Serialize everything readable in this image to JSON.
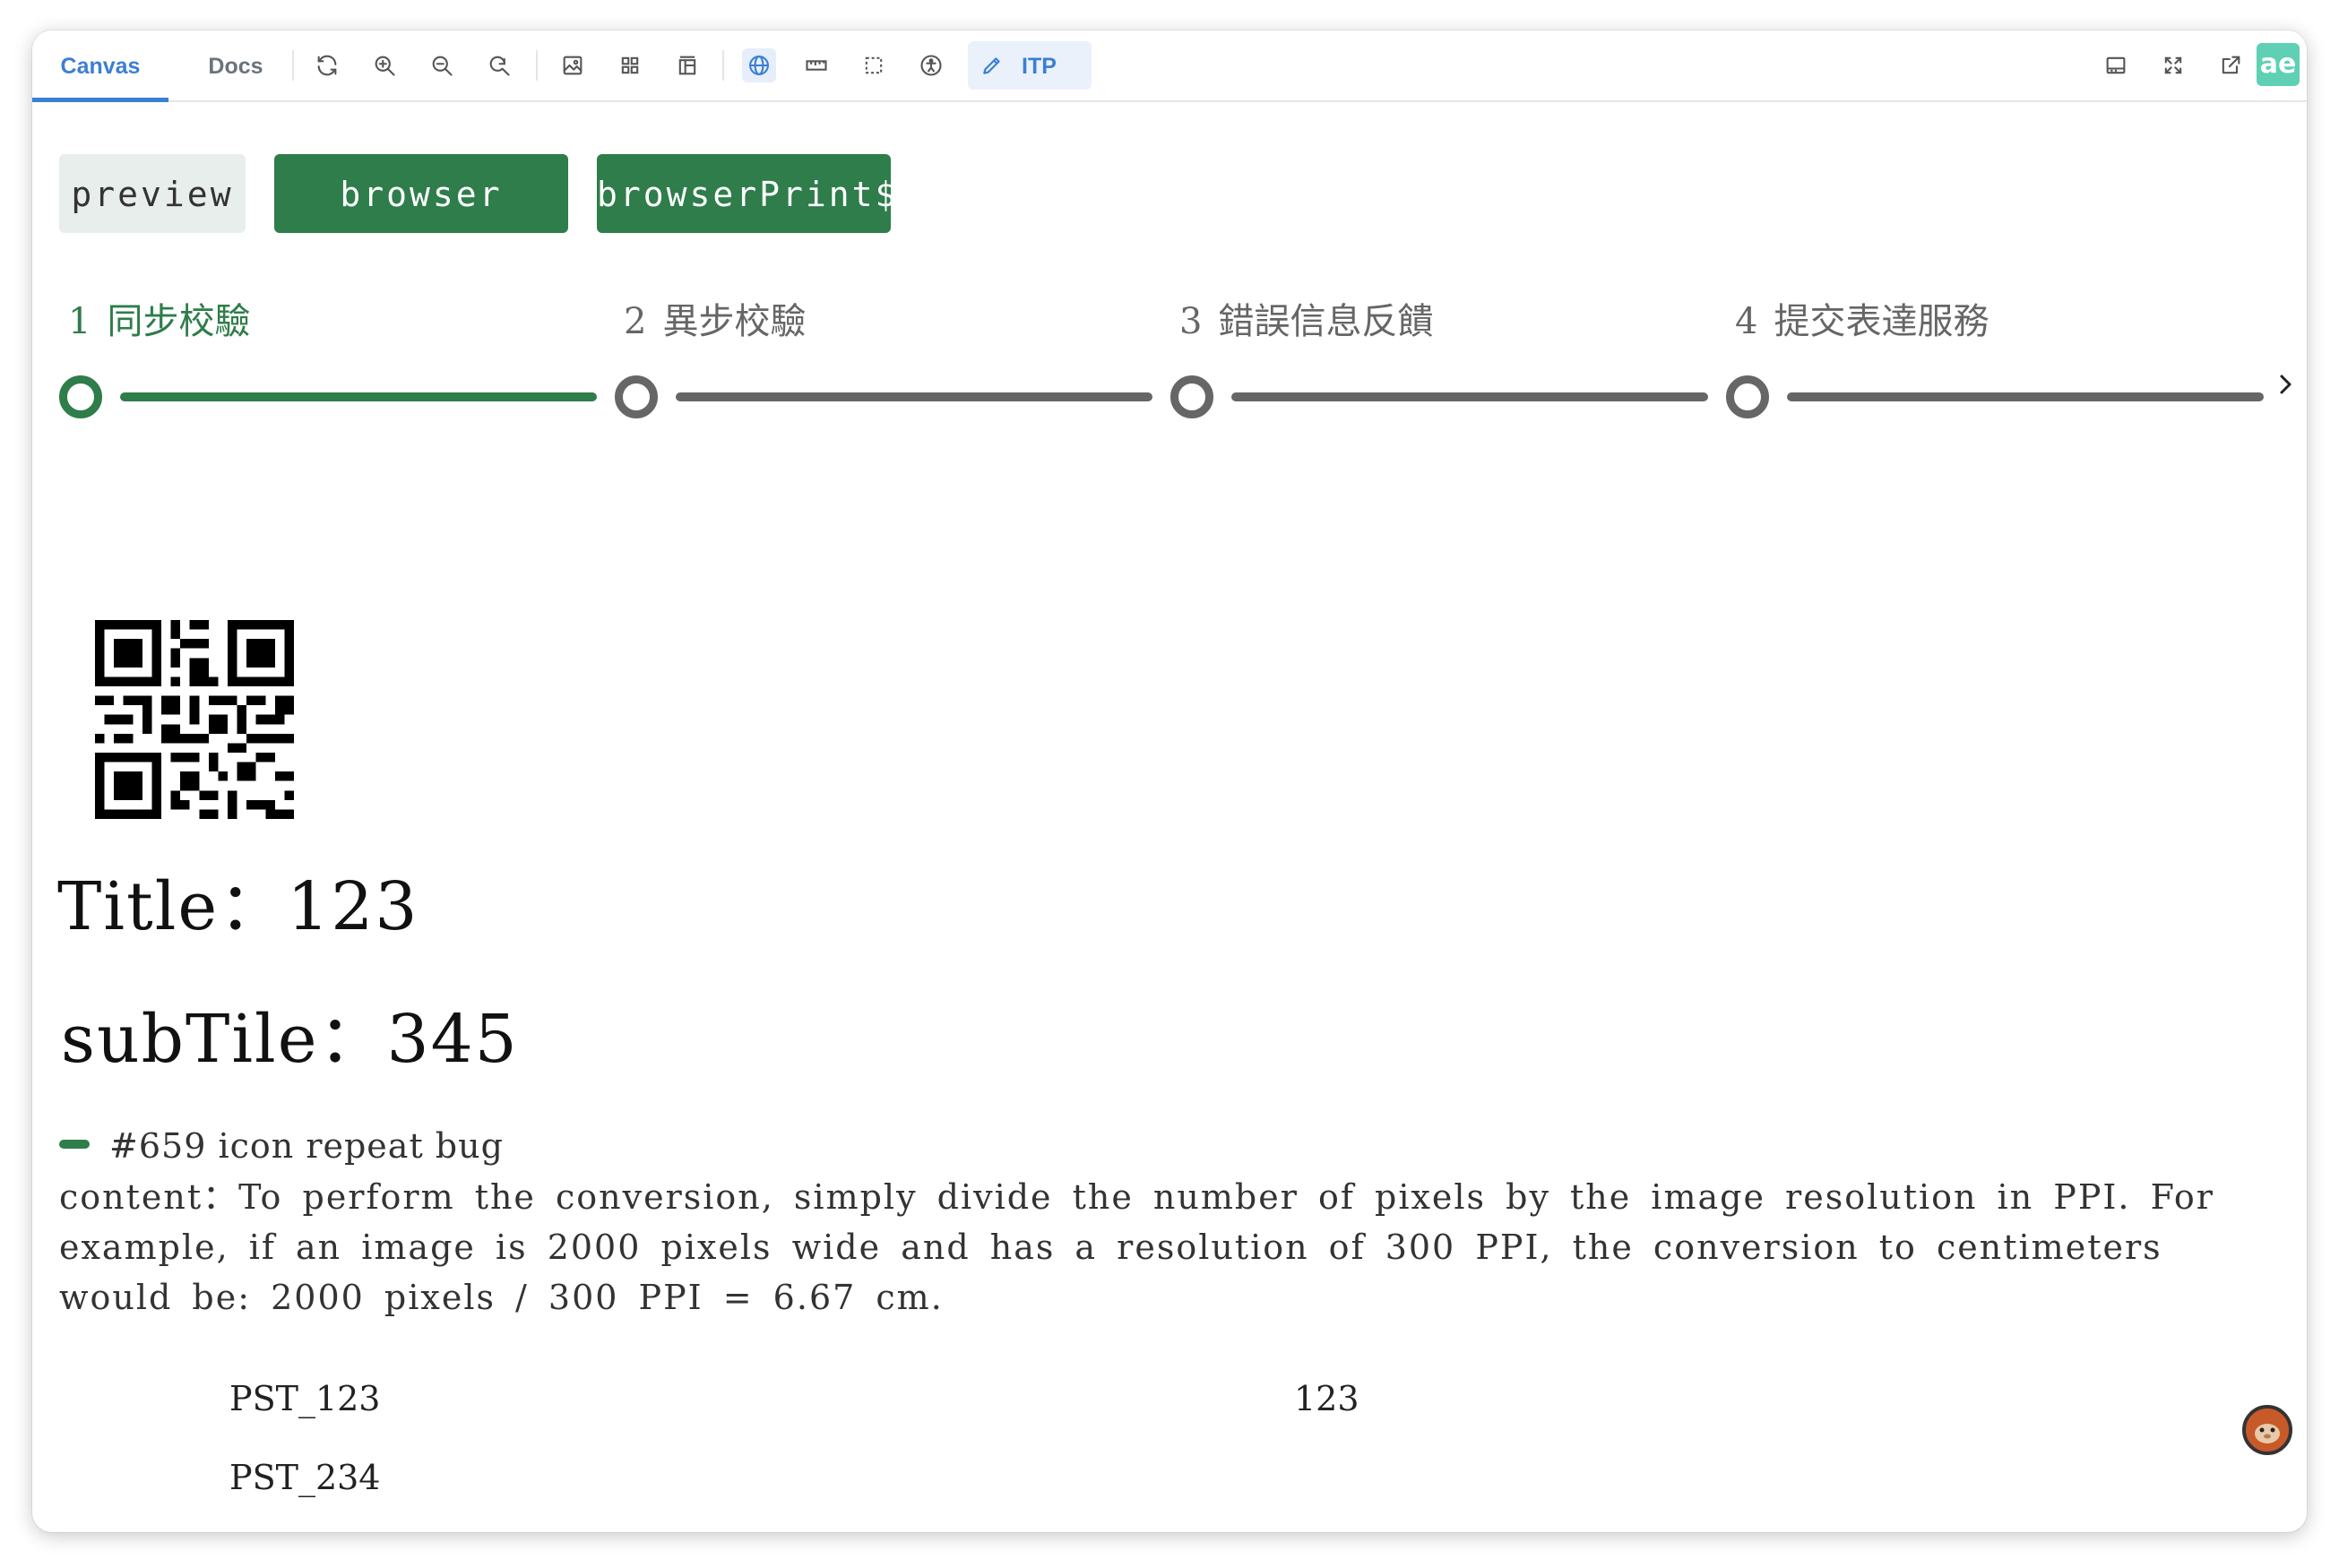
{
  "tabs": [
    {
      "label": "Canvas",
      "active": true
    },
    {
      "label": "Docs",
      "active": false
    }
  ],
  "toolbar": {
    "icons": [
      "refresh-icon",
      "zoom-in-icon",
      "zoom-out-icon",
      "zoom-reset-icon",
      "image-icon",
      "grid-icon",
      "layout-icon",
      "globe-icon",
      "ruler-icon",
      "outline-icon",
      "accessibility-icon"
    ],
    "itp_label": "ITP",
    "right_icons": [
      "panel-icon",
      "fullscreen-icon",
      "open-external-icon"
    ],
    "brand": "ae",
    "accent_color": "#3b7fd4"
  },
  "buttons": {
    "preview": "preview",
    "browser_print": "browser print",
    "browser_print_obs": "browserPrint$"
  },
  "steps": [
    {
      "num": "1",
      "label": "同步校驗",
      "active": true
    },
    {
      "num": "2",
      "label": "異步校驗",
      "active": false
    },
    {
      "num": "3",
      "label": "錯誤信息反饋",
      "active": false
    },
    {
      "num": "4",
      "label": "提交表達服務",
      "active": false
    }
  ],
  "step_colors": {
    "active": "#2e7d4a",
    "inactive": "#666666"
  },
  "doc": {
    "title": "Title：123",
    "subtitle": "subTile：345",
    "tag": "#659 icon repeat bug",
    "content": "content：To perform the conversion, simply divide the number of pixels by the image resolution in PPI. For example, if an image is 2000 pixels wide and has a resolution of 300 PPI, the conversion to centimeters would be: 2000 pixels / 300 PPI = 6.67 cm.",
    "table": [
      [
        "PST_123",
        "123"
      ],
      [
        "PST_234",
        ""
      ]
    ]
  }
}
